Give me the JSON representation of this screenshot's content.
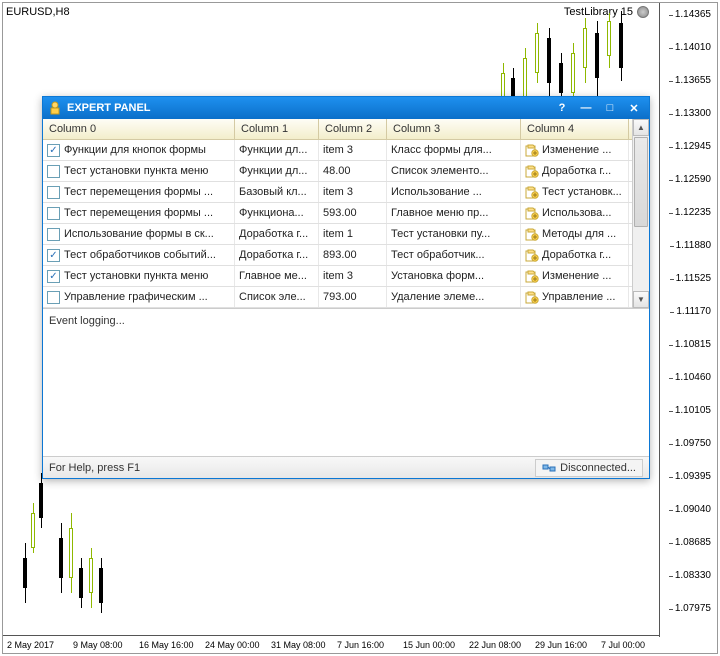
{
  "chart": {
    "symbol": "EURUSD,H8",
    "library": "TestLibrary 15",
    "y_ticks": [
      "1.14365",
      "1.14010",
      "1.13655",
      "1.13300",
      "1.12945",
      "1.12590",
      "1.12235",
      "1.11880",
      "1.11525",
      "1.11170",
      "1.10815",
      "1.10460",
      "1.10105",
      "1.09750",
      "1.09395",
      "1.09040",
      "1.08685",
      "1.08330",
      "1.07975"
    ],
    "x_ticks": [
      "2 May 2017",
      "9 May 08:00",
      "16 May 16:00",
      "24 May 00:00",
      "31 May 08:00",
      "7 Jun 16:00",
      "15 Jun 00:00",
      "22 Jun 08:00",
      "29 Jun 16:00",
      "7 Jul 00:00"
    ]
  },
  "panel": {
    "title": "EXPERT PANEL",
    "columns": [
      "Column 0",
      "Column 1",
      "Column 2",
      "Column 3",
      "Column 4"
    ],
    "rows": [
      {
        "chk": true,
        "c0": "Функции для кнопок формы",
        "c1": "Функции дл...",
        "c2": "item 3",
        "c3": "Класс формы для...",
        "c4": "Изменение ..."
      },
      {
        "chk": false,
        "c0": "Тест установки пункта меню",
        "c1": "Функции дл...",
        "c2": "48.00",
        "c3": "Список элементо...",
        "c4": "Доработка г..."
      },
      {
        "chk": false,
        "c0": "Тест перемещения формы ...",
        "c1": "Базовый кл...",
        "c2": "item 3",
        "c3": "Использование ...",
        "c4": "Тест установк..."
      },
      {
        "chk": false,
        "c0": "Тест перемещения формы ...",
        "c1": "Функциона...",
        "c2": "593.00",
        "c3": "Главное меню пр...",
        "c4": "Использова..."
      },
      {
        "chk": false,
        "c0": "Использование формы в ск...",
        "c1": "Доработка г...",
        "c2": "item 1",
        "c3": "Тест установки пу...",
        "c4": "Методы для ..."
      },
      {
        "chk": true,
        "c0": "Тест обработчиков событий...",
        "c1": "Доработка г...",
        "c2": "893.00",
        "c3": "Тест обработчик...",
        "c4": "Доработка г..."
      },
      {
        "chk": true,
        "c0": "Тест установки пункта меню",
        "c1": "Главное ме...",
        "c2": "item 3",
        "c3": "Установка форм...",
        "c4": "Изменение ..."
      },
      {
        "chk": false,
        "c0": "Управление графическим ...",
        "c1": "Список эле...",
        "c2": "793.00",
        "c3": "Удаление элеме...",
        "c4": "Управление ..."
      }
    ],
    "log": "Event logging...",
    "help": "For Help, press F1",
    "net": "Disconnected..."
  }
}
